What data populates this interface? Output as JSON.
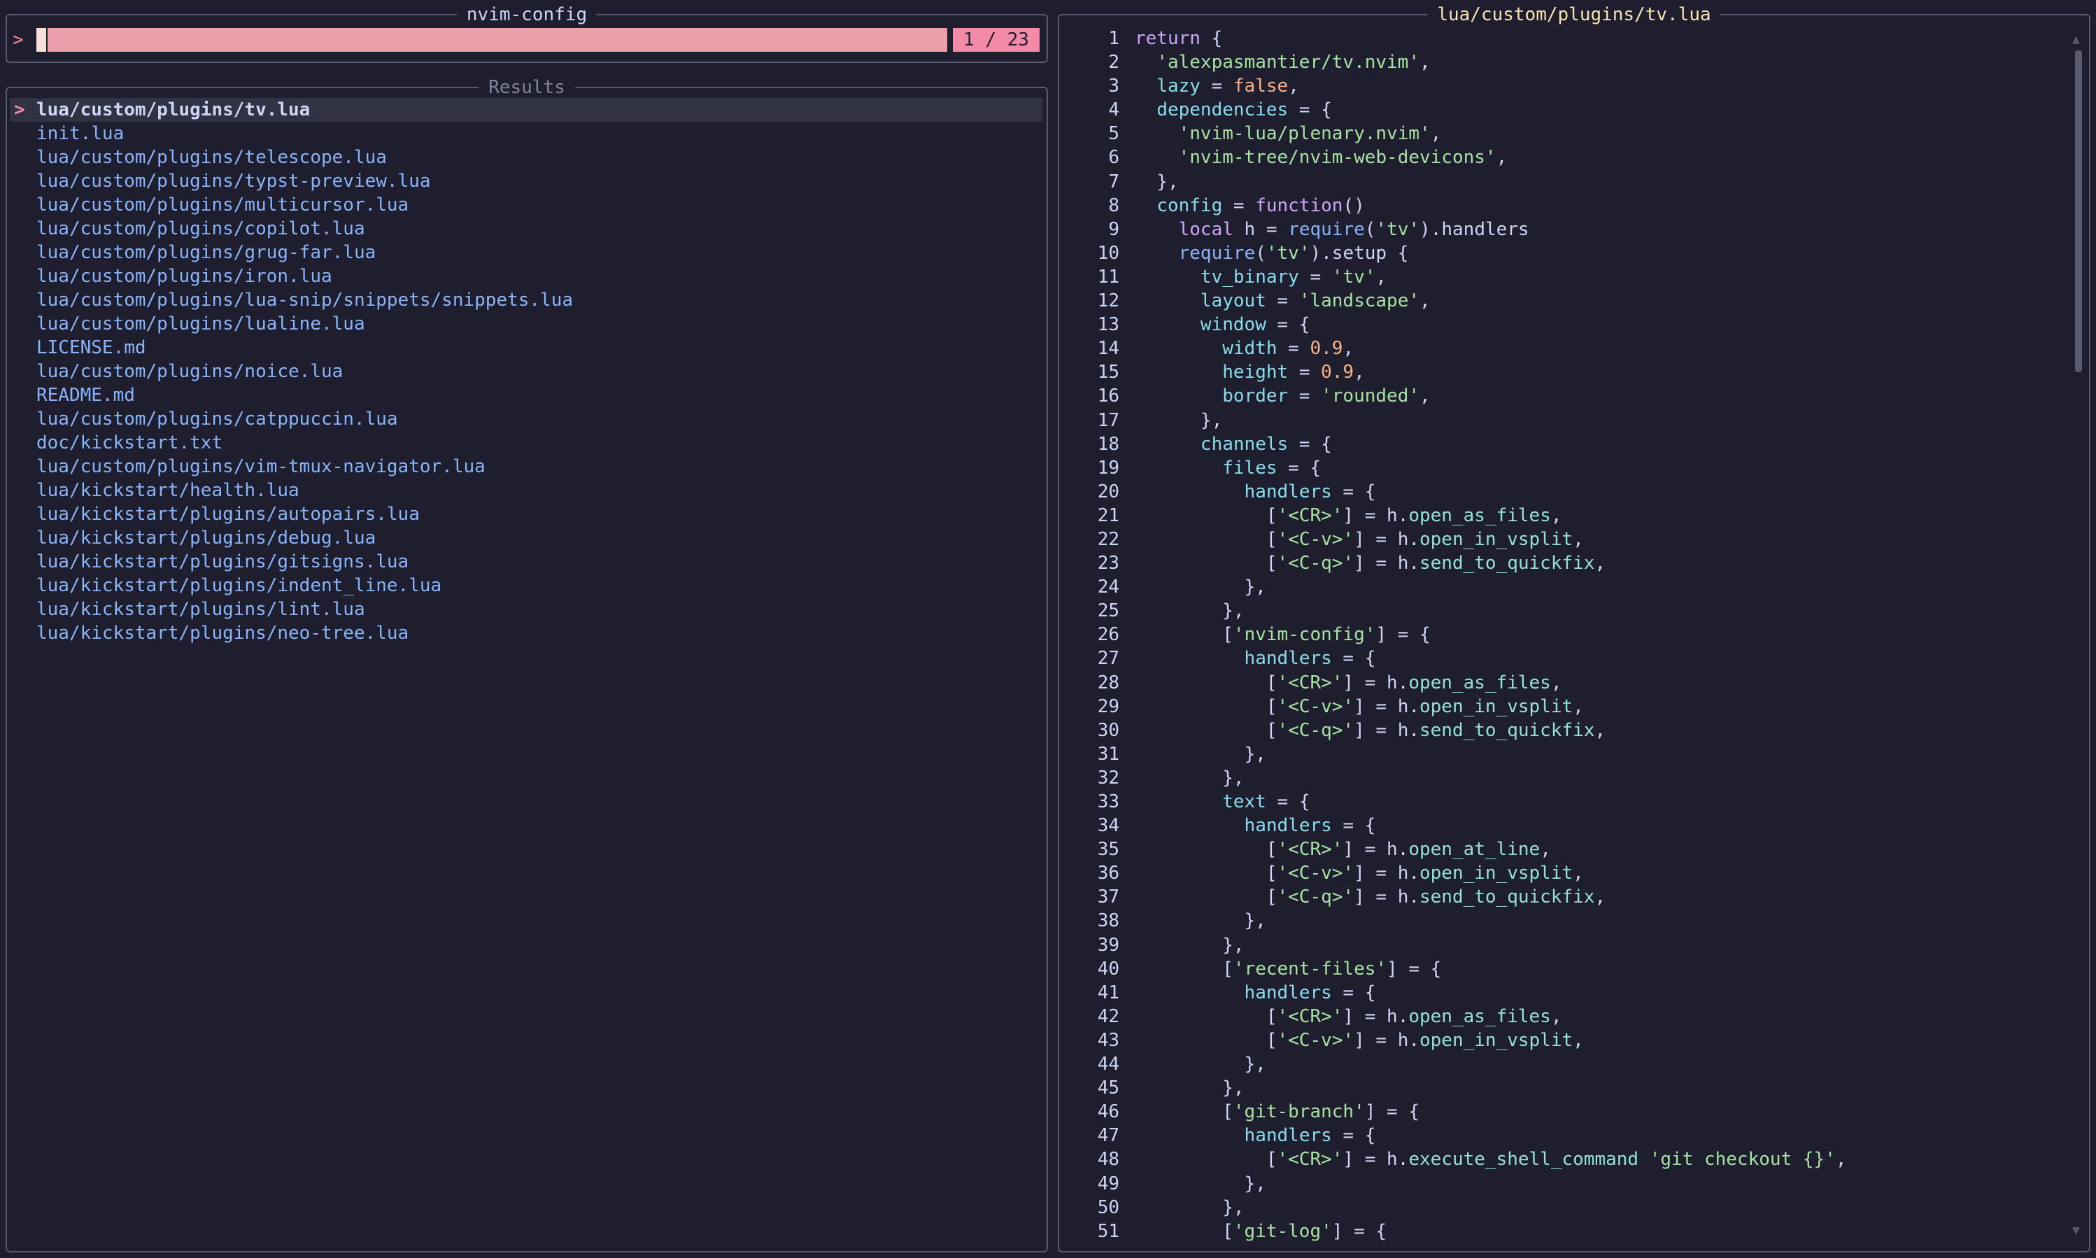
{
  "input": {
    "title": "nvim-config",
    "prompt": ">",
    "count": "1 / 23"
  },
  "results": {
    "title": "Results",
    "marker": ">",
    "items": [
      "lua/custom/plugins/tv.lua",
      "init.lua",
      "lua/custom/plugins/telescope.lua",
      "lua/custom/plugins/typst-preview.lua",
      "lua/custom/plugins/multicursor.lua",
      "lua/custom/plugins/copilot.lua",
      "lua/custom/plugins/grug-far.lua",
      "lua/custom/plugins/iron.lua",
      "lua/custom/plugins/lua-snip/snippets/snippets.lua",
      "lua/custom/plugins/lualine.lua",
      "LICENSE.md",
      "lua/custom/plugins/noice.lua",
      "README.md",
      "lua/custom/plugins/catppuccin.lua",
      "doc/kickstart.txt",
      "lua/custom/plugins/vim-tmux-navigator.lua",
      "lua/kickstart/health.lua",
      "lua/kickstart/plugins/autopairs.lua",
      "lua/kickstart/plugins/debug.lua",
      "lua/kickstart/plugins/gitsigns.lua",
      "lua/kickstart/plugins/indent_line.lua",
      "lua/kickstart/plugins/lint.lua",
      "lua/kickstart/plugins/neo-tree.lua"
    ]
  },
  "preview": {
    "title": "lua/custom/plugins/tv.lua",
    "lines": [
      [
        [
          "kw",
          "return"
        ],
        [
          "plain",
          " {"
        ]
      ],
      [
        [
          "plain",
          "  "
        ],
        [
          "str",
          "'alexpasmantier/tv.nvim'"
        ],
        [
          "plain",
          ","
        ]
      ],
      [
        [
          "plain",
          "  "
        ],
        [
          "key",
          "lazy"
        ],
        [
          "plain",
          " = "
        ],
        [
          "num",
          "false"
        ],
        [
          "plain",
          ","
        ]
      ],
      [
        [
          "plain",
          "  "
        ],
        [
          "key",
          "dependencies"
        ],
        [
          "plain",
          " = {"
        ]
      ],
      [
        [
          "plain",
          "    "
        ],
        [
          "str",
          "'nvim-lua/plenary.nvim'"
        ],
        [
          "plain",
          ","
        ]
      ],
      [
        [
          "plain",
          "    "
        ],
        [
          "str",
          "'nvim-tree/nvim-web-devicons'"
        ],
        [
          "plain",
          ","
        ]
      ],
      [
        [
          "plain",
          "  },"
        ]
      ],
      [
        [
          "plain",
          "  "
        ],
        [
          "key",
          "config"
        ],
        [
          "plain",
          " = "
        ],
        [
          "kw",
          "function"
        ],
        [
          "plain",
          "()"
        ]
      ],
      [
        [
          "plain",
          "    "
        ],
        [
          "kw",
          "local"
        ],
        [
          "plain",
          " h = "
        ],
        [
          "fn",
          "require"
        ],
        [
          "plain",
          "("
        ],
        [
          "str",
          "'tv'"
        ],
        [
          "plain",
          ").handlers"
        ]
      ],
      [
        [
          "plain",
          "    "
        ],
        [
          "fn",
          "require"
        ],
        [
          "plain",
          "("
        ],
        [
          "str",
          "'tv'"
        ],
        [
          "plain",
          ").setup {"
        ]
      ],
      [
        [
          "plain",
          "      "
        ],
        [
          "key",
          "tv_binary"
        ],
        [
          "plain",
          " = "
        ],
        [
          "str",
          "'tv'"
        ],
        [
          "plain",
          ","
        ]
      ],
      [
        [
          "plain",
          "      "
        ],
        [
          "key",
          "layout"
        ],
        [
          "plain",
          " = "
        ],
        [
          "str",
          "'landscape'"
        ],
        [
          "plain",
          ","
        ]
      ],
      [
        [
          "plain",
          "      "
        ],
        [
          "key",
          "window"
        ],
        [
          "plain",
          " = {"
        ]
      ],
      [
        [
          "plain",
          "        "
        ],
        [
          "key",
          "width"
        ],
        [
          "plain",
          " = "
        ],
        [
          "num",
          "0.9"
        ],
        [
          "plain",
          ","
        ]
      ],
      [
        [
          "plain",
          "        "
        ],
        [
          "key",
          "height"
        ],
        [
          "plain",
          " = "
        ],
        [
          "num",
          "0.9"
        ],
        [
          "plain",
          ","
        ]
      ],
      [
        [
          "plain",
          "        "
        ],
        [
          "key",
          "border"
        ],
        [
          "plain",
          " = "
        ],
        [
          "str",
          "'rounded'"
        ],
        [
          "plain",
          ","
        ]
      ],
      [
        [
          "plain",
          "      },"
        ]
      ],
      [
        [
          "plain",
          "      "
        ],
        [
          "key",
          "channels"
        ],
        [
          "plain",
          " = {"
        ]
      ],
      [
        [
          "plain",
          "        "
        ],
        [
          "key",
          "files"
        ],
        [
          "plain",
          " = {"
        ]
      ],
      [
        [
          "plain",
          "          "
        ],
        [
          "key",
          "handlers"
        ],
        [
          "plain",
          " = {"
        ]
      ],
      [
        [
          "plain",
          "            ["
        ],
        [
          "str",
          "'<CR>'"
        ],
        [
          "plain",
          "] = h."
        ],
        [
          "field",
          "open_as_files"
        ],
        [
          "plain",
          ","
        ]
      ],
      [
        [
          "plain",
          "            ["
        ],
        [
          "str",
          "'<C-v>'"
        ],
        [
          "plain",
          "] = h."
        ],
        [
          "field",
          "open_in_vsplit"
        ],
        [
          "plain",
          ","
        ]
      ],
      [
        [
          "plain",
          "            ["
        ],
        [
          "str",
          "'<C-q>'"
        ],
        [
          "plain",
          "] = h."
        ],
        [
          "field",
          "send_to_quickfix"
        ],
        [
          "plain",
          ","
        ]
      ],
      [
        [
          "plain",
          "          },"
        ]
      ],
      [
        [
          "plain",
          "        },"
        ]
      ],
      [
        [
          "plain",
          "        ["
        ],
        [
          "str",
          "'nvim-config'"
        ],
        [
          "plain",
          "] = {"
        ]
      ],
      [
        [
          "plain",
          "          "
        ],
        [
          "key",
          "handlers"
        ],
        [
          "plain",
          " = {"
        ]
      ],
      [
        [
          "plain",
          "            ["
        ],
        [
          "str",
          "'<CR>'"
        ],
        [
          "plain",
          "] = h."
        ],
        [
          "field",
          "open_as_files"
        ],
        [
          "plain",
          ","
        ]
      ],
      [
        [
          "plain",
          "            ["
        ],
        [
          "str",
          "'<C-v>'"
        ],
        [
          "plain",
          "] = h."
        ],
        [
          "field",
          "open_in_vsplit"
        ],
        [
          "plain",
          ","
        ]
      ],
      [
        [
          "plain",
          "            ["
        ],
        [
          "str",
          "'<C-q>'"
        ],
        [
          "plain",
          "] = h."
        ],
        [
          "field",
          "send_to_quickfix"
        ],
        [
          "plain",
          ","
        ]
      ],
      [
        [
          "plain",
          "          },"
        ]
      ],
      [
        [
          "plain",
          "        },"
        ]
      ],
      [
        [
          "plain",
          "        "
        ],
        [
          "key",
          "text"
        ],
        [
          "plain",
          " = {"
        ]
      ],
      [
        [
          "plain",
          "          "
        ],
        [
          "key",
          "handlers"
        ],
        [
          "plain",
          " = {"
        ]
      ],
      [
        [
          "plain",
          "            ["
        ],
        [
          "str",
          "'<CR>'"
        ],
        [
          "plain",
          "] = h."
        ],
        [
          "field",
          "open_at_line"
        ],
        [
          "plain",
          ","
        ]
      ],
      [
        [
          "plain",
          "            ["
        ],
        [
          "str",
          "'<C-v>'"
        ],
        [
          "plain",
          "] = h."
        ],
        [
          "field",
          "open_in_vsplit"
        ],
        [
          "plain",
          ","
        ]
      ],
      [
        [
          "plain",
          "            ["
        ],
        [
          "str",
          "'<C-q>'"
        ],
        [
          "plain",
          "] = h."
        ],
        [
          "field",
          "send_to_quickfix"
        ],
        [
          "plain",
          ","
        ]
      ],
      [
        [
          "plain",
          "          },"
        ]
      ],
      [
        [
          "plain",
          "        },"
        ]
      ],
      [
        [
          "plain",
          "        ["
        ],
        [
          "str",
          "'recent-files'"
        ],
        [
          "plain",
          "] = {"
        ]
      ],
      [
        [
          "plain",
          "          "
        ],
        [
          "key",
          "handlers"
        ],
        [
          "plain",
          " = {"
        ]
      ],
      [
        [
          "plain",
          "            ["
        ],
        [
          "str",
          "'<CR>'"
        ],
        [
          "plain",
          "] = h."
        ],
        [
          "field",
          "open_as_files"
        ],
        [
          "plain",
          ","
        ]
      ],
      [
        [
          "plain",
          "            ["
        ],
        [
          "str",
          "'<C-v>'"
        ],
        [
          "plain",
          "] = h."
        ],
        [
          "field",
          "open_in_vsplit"
        ],
        [
          "plain",
          ","
        ]
      ],
      [
        [
          "plain",
          "          },"
        ]
      ],
      [
        [
          "plain",
          "        },"
        ]
      ],
      [
        [
          "plain",
          "        ["
        ],
        [
          "str",
          "'git-branch'"
        ],
        [
          "plain",
          "] = {"
        ]
      ],
      [
        [
          "plain",
          "          "
        ],
        [
          "key",
          "handlers"
        ],
        [
          "plain",
          " = {"
        ]
      ],
      [
        [
          "plain",
          "            ["
        ],
        [
          "str",
          "'<CR>'"
        ],
        [
          "plain",
          "] = h."
        ],
        [
          "field",
          "execute_shell_command"
        ],
        [
          "plain",
          " "
        ],
        [
          "str",
          "'git checkout {}'"
        ],
        [
          "plain",
          ","
        ]
      ],
      [
        [
          "plain",
          "          },"
        ]
      ],
      [
        [
          "plain",
          "        },"
        ]
      ],
      [
        [
          "plain",
          "        ["
        ],
        [
          "str",
          "'git-log'"
        ],
        [
          "plain",
          "] = {"
        ]
      ]
    ]
  },
  "scroll": {
    "up_glyph": "▲",
    "down_glyph": "▼"
  },
  "colors": {
    "background": "#1e1e2e",
    "accent": "#f38ba8",
    "prompt_bar": "#eba0ac",
    "result_text": "#89b4fa",
    "preview_title": "#f9e2af",
    "border": "#585b70"
  }
}
